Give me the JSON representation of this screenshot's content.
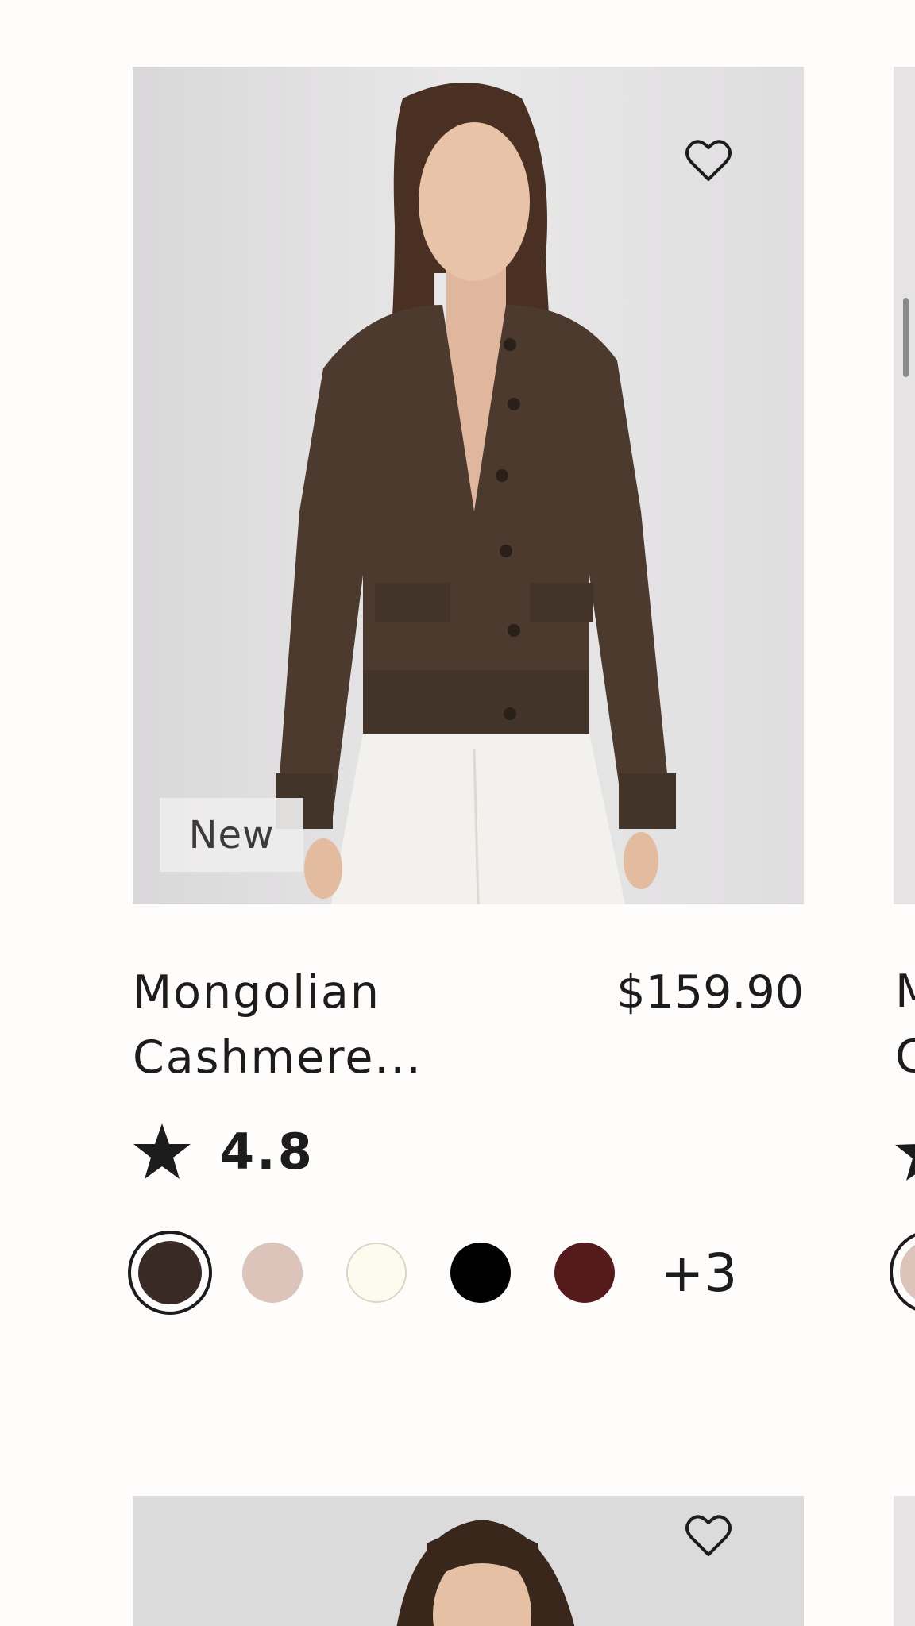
{
  "products": [
    {
      "badge": "New",
      "name_line1": "Mongolian",
      "name_line2": "Cashmere...",
      "price": "$159.90",
      "rating": "4.8",
      "swatches": [
        {
          "color": "#3a2a25",
          "selected": true
        },
        {
          "color": "#dcc4bb",
          "selected": false
        },
        {
          "color": "#fbfcee",
          "selected": false
        },
        {
          "color": "#000000",
          "selected": false
        },
        {
          "color": "#561a1d",
          "selected": false
        }
      ],
      "more_colors": "+3",
      "icons": {
        "wishlist": "heart-outline-icon",
        "rating": "star-icon"
      }
    }
  ],
  "peek": {
    "name_line1": "M",
    "name_line2": "C"
  }
}
